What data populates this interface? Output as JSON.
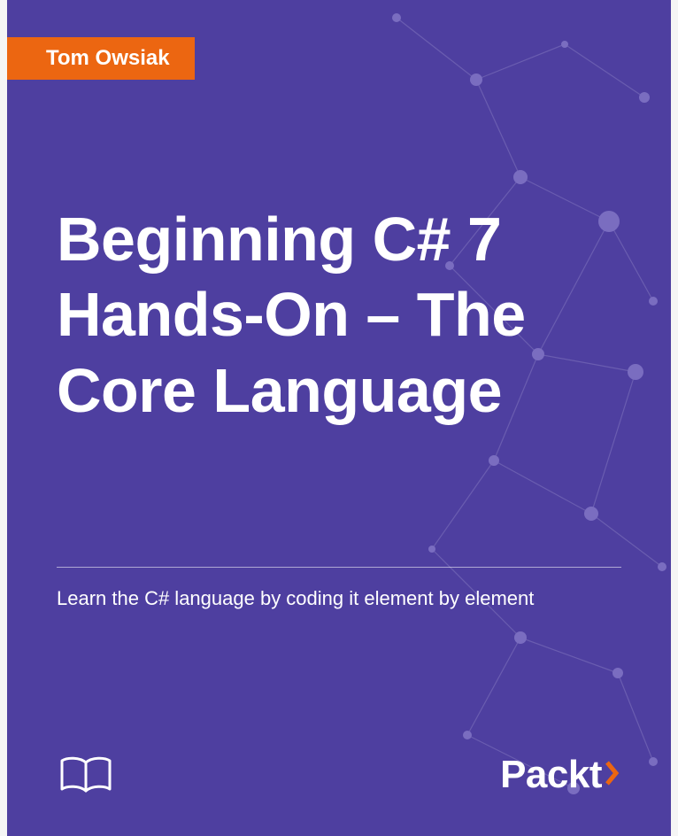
{
  "author": "Tom Owsiak",
  "title": "Beginning C# 7 Hands-On – The Core Language",
  "subtitle": "Learn the C# language by coding it element by element",
  "publisher": "Packt",
  "colors": {
    "background": "#4e3fa0",
    "accent": "#ec6611",
    "text": "#ffffff"
  },
  "icons": {
    "book": "book-icon",
    "chevron": "chevron-right-icon"
  }
}
